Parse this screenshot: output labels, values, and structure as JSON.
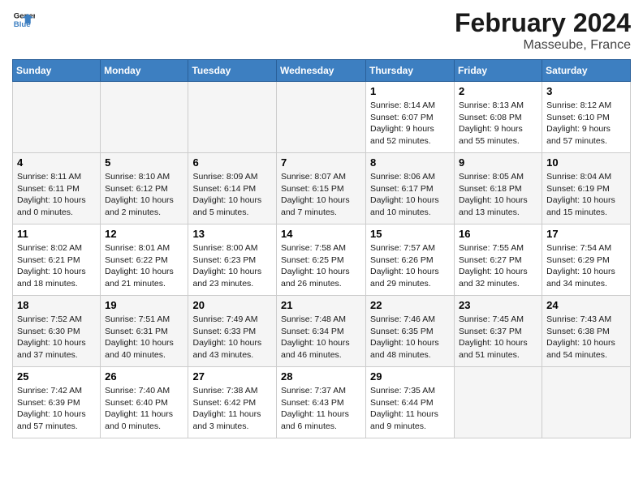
{
  "header": {
    "logo_line1": "General",
    "logo_line2": "Blue",
    "month_title": "February 2024",
    "location": "Masseube, France"
  },
  "days_of_week": [
    "Sunday",
    "Monday",
    "Tuesday",
    "Wednesday",
    "Thursday",
    "Friday",
    "Saturday"
  ],
  "weeks": [
    [
      {
        "day": "",
        "info": ""
      },
      {
        "day": "",
        "info": ""
      },
      {
        "day": "",
        "info": ""
      },
      {
        "day": "",
        "info": ""
      },
      {
        "day": "1",
        "info": "Sunrise: 8:14 AM\nSunset: 6:07 PM\nDaylight: 9 hours\nand 52 minutes."
      },
      {
        "day": "2",
        "info": "Sunrise: 8:13 AM\nSunset: 6:08 PM\nDaylight: 9 hours\nand 55 minutes."
      },
      {
        "day": "3",
        "info": "Sunrise: 8:12 AM\nSunset: 6:10 PM\nDaylight: 9 hours\nand 57 minutes."
      }
    ],
    [
      {
        "day": "4",
        "info": "Sunrise: 8:11 AM\nSunset: 6:11 PM\nDaylight: 10 hours\nand 0 minutes."
      },
      {
        "day": "5",
        "info": "Sunrise: 8:10 AM\nSunset: 6:12 PM\nDaylight: 10 hours\nand 2 minutes."
      },
      {
        "day": "6",
        "info": "Sunrise: 8:09 AM\nSunset: 6:14 PM\nDaylight: 10 hours\nand 5 minutes."
      },
      {
        "day": "7",
        "info": "Sunrise: 8:07 AM\nSunset: 6:15 PM\nDaylight: 10 hours\nand 7 minutes."
      },
      {
        "day": "8",
        "info": "Sunrise: 8:06 AM\nSunset: 6:17 PM\nDaylight: 10 hours\nand 10 minutes."
      },
      {
        "day": "9",
        "info": "Sunrise: 8:05 AM\nSunset: 6:18 PM\nDaylight: 10 hours\nand 13 minutes."
      },
      {
        "day": "10",
        "info": "Sunrise: 8:04 AM\nSunset: 6:19 PM\nDaylight: 10 hours\nand 15 minutes."
      }
    ],
    [
      {
        "day": "11",
        "info": "Sunrise: 8:02 AM\nSunset: 6:21 PM\nDaylight: 10 hours\nand 18 minutes."
      },
      {
        "day": "12",
        "info": "Sunrise: 8:01 AM\nSunset: 6:22 PM\nDaylight: 10 hours\nand 21 minutes."
      },
      {
        "day": "13",
        "info": "Sunrise: 8:00 AM\nSunset: 6:23 PM\nDaylight: 10 hours\nand 23 minutes."
      },
      {
        "day": "14",
        "info": "Sunrise: 7:58 AM\nSunset: 6:25 PM\nDaylight: 10 hours\nand 26 minutes."
      },
      {
        "day": "15",
        "info": "Sunrise: 7:57 AM\nSunset: 6:26 PM\nDaylight: 10 hours\nand 29 minutes."
      },
      {
        "day": "16",
        "info": "Sunrise: 7:55 AM\nSunset: 6:27 PM\nDaylight: 10 hours\nand 32 minutes."
      },
      {
        "day": "17",
        "info": "Sunrise: 7:54 AM\nSunset: 6:29 PM\nDaylight: 10 hours\nand 34 minutes."
      }
    ],
    [
      {
        "day": "18",
        "info": "Sunrise: 7:52 AM\nSunset: 6:30 PM\nDaylight: 10 hours\nand 37 minutes."
      },
      {
        "day": "19",
        "info": "Sunrise: 7:51 AM\nSunset: 6:31 PM\nDaylight: 10 hours\nand 40 minutes."
      },
      {
        "day": "20",
        "info": "Sunrise: 7:49 AM\nSunset: 6:33 PM\nDaylight: 10 hours\nand 43 minutes."
      },
      {
        "day": "21",
        "info": "Sunrise: 7:48 AM\nSunset: 6:34 PM\nDaylight: 10 hours\nand 46 minutes."
      },
      {
        "day": "22",
        "info": "Sunrise: 7:46 AM\nSunset: 6:35 PM\nDaylight: 10 hours\nand 48 minutes."
      },
      {
        "day": "23",
        "info": "Sunrise: 7:45 AM\nSunset: 6:37 PM\nDaylight: 10 hours\nand 51 minutes."
      },
      {
        "day": "24",
        "info": "Sunrise: 7:43 AM\nSunset: 6:38 PM\nDaylight: 10 hours\nand 54 minutes."
      }
    ],
    [
      {
        "day": "25",
        "info": "Sunrise: 7:42 AM\nSunset: 6:39 PM\nDaylight: 10 hours\nand 57 minutes."
      },
      {
        "day": "26",
        "info": "Sunrise: 7:40 AM\nSunset: 6:40 PM\nDaylight: 11 hours\nand 0 minutes."
      },
      {
        "day": "27",
        "info": "Sunrise: 7:38 AM\nSunset: 6:42 PM\nDaylight: 11 hours\nand 3 minutes."
      },
      {
        "day": "28",
        "info": "Sunrise: 7:37 AM\nSunset: 6:43 PM\nDaylight: 11 hours\nand 6 minutes."
      },
      {
        "day": "29",
        "info": "Sunrise: 7:35 AM\nSunset: 6:44 PM\nDaylight: 11 hours\nand 9 minutes."
      },
      {
        "day": "",
        "info": ""
      },
      {
        "day": "",
        "info": ""
      }
    ]
  ]
}
